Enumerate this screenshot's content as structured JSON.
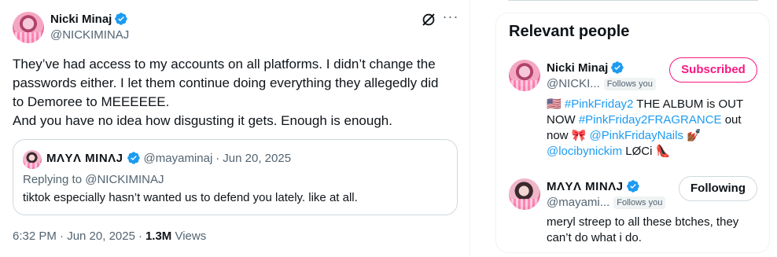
{
  "tweet": {
    "author_name": "Nicki Minaj",
    "author_handle": "@NICKIMINAJ",
    "body_lines": [
      "They’ve had access to my accounts on all platforms. I didn’t change the",
      "passwords either.  I let them continue doing everything they allegedly did",
      "to Demoree to MEEEEEE.",
      "And you have no idea how disgusting it gets. Enough is enough."
    ],
    "quote": {
      "name": "MΛYΛ MINΛJ",
      "handle": "@mayaminaj",
      "separator": "·",
      "date": "Jun 20, 2025",
      "replying_to": "Replying to @NICKIMINAJ",
      "text": "tiktok especially hasn’t wanted us to defend you lately. like at all."
    },
    "timestamp": "6:32 PM · Jun 20, 2025",
    "separator": "·",
    "views_count": "1.3M",
    "views_label": "Views",
    "more_icon": "···"
  },
  "sidebar": {
    "title": "Relevant people",
    "people": [
      {
        "name": "Nicki Minaj",
        "handle": "@NICKI...",
        "follows_you": "Follows you",
        "button": "Subscribed",
        "bio": {
          "flag": "🇺🇸",
          "tag1": "#PinkFriday2",
          "text1": " THE ALBUM is OUT NOW ",
          "tag2": "#PinkFriday2FRAGRANCE",
          "text2": " out now ",
          "bow": "🎀",
          "tag3": "@PinkFridayNails",
          "nails": "💅🏾",
          "tag4": "@locibynickim",
          "text4": " LØCi ",
          "heel": "👠"
        }
      },
      {
        "name": "MΛYΛ MINΛJ",
        "handle": "@mayami...",
        "follows_you": "Follows you",
        "button": "Following",
        "bio": "meryl streep to all these btches, they can’t do what i do."
      }
    ]
  },
  "colors": {
    "verified": "#1d9bf0",
    "link": "#1d9bf0",
    "subscribed": "#f91880",
    "muted": "#536471"
  }
}
